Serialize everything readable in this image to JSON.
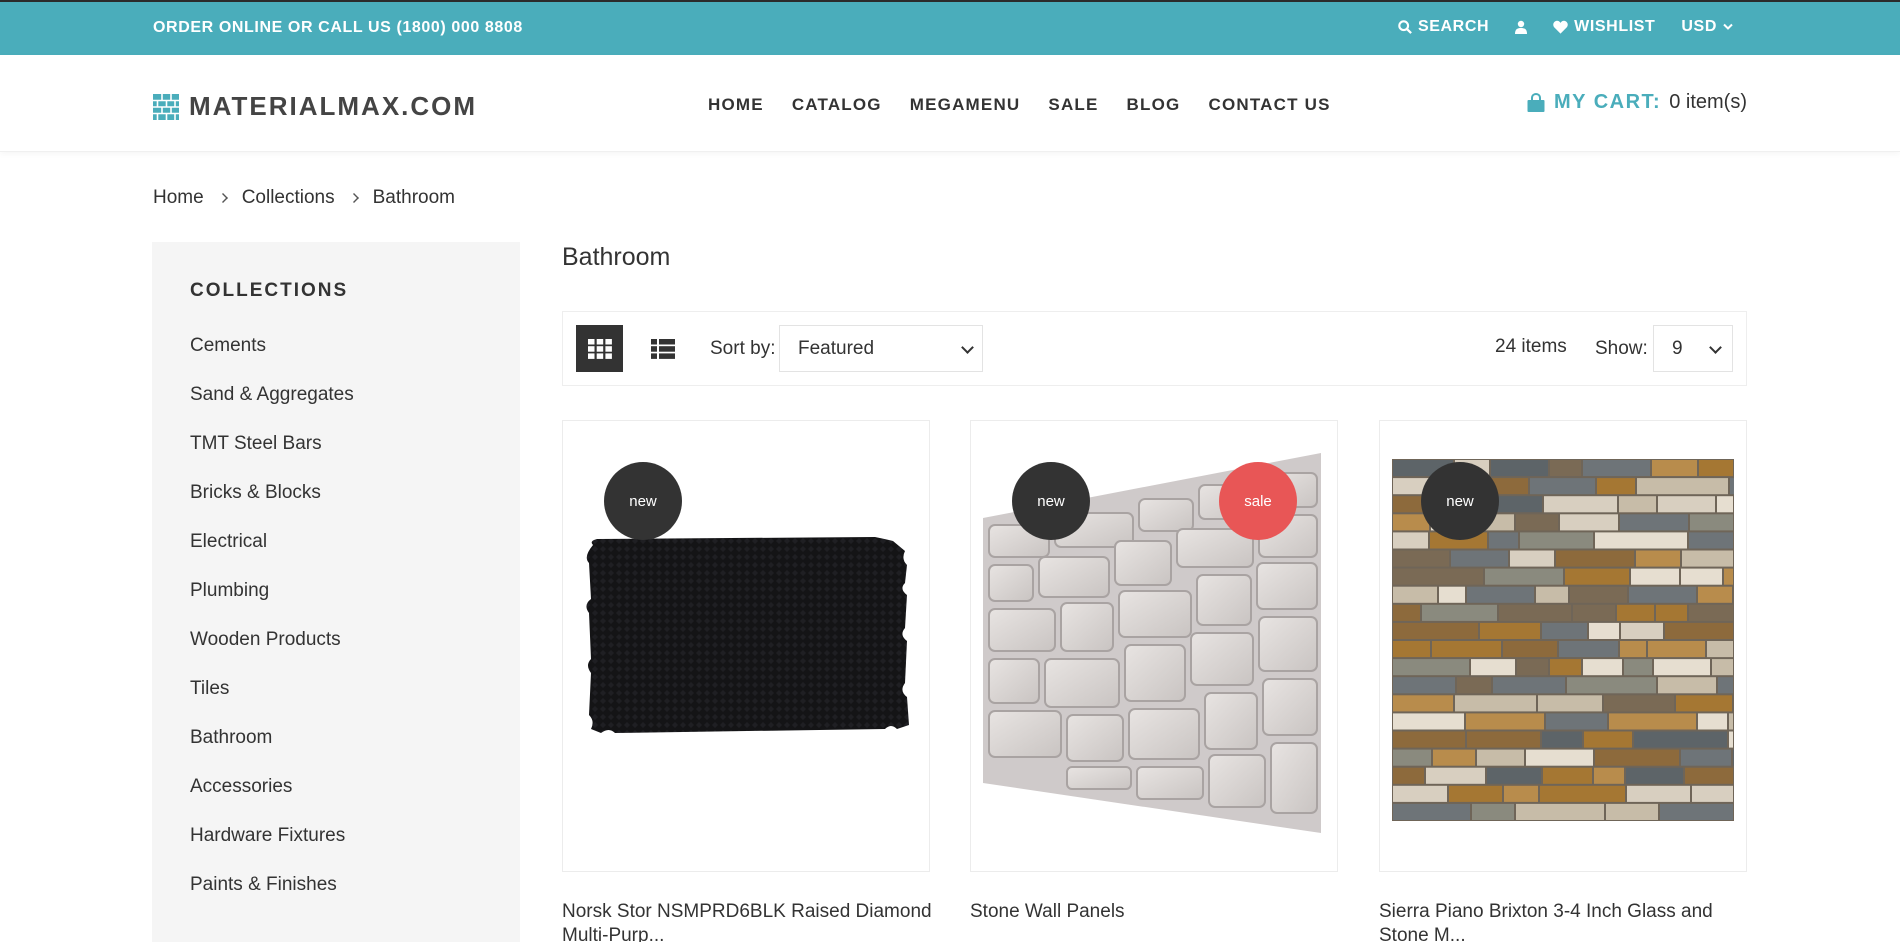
{
  "topbar": {
    "phone_text": "ORDER ONLINE OR CALL US (1800) 000 8808",
    "search_label": "SEARCH",
    "wishlist_label": "WISHLIST",
    "currency": "USD"
  },
  "header": {
    "logo_text": "MATERIALMAX.COM",
    "nav": [
      "HOME",
      "CATALOG",
      "MEGAMENU",
      "SALE",
      "BLOG",
      "CONTACT US"
    ],
    "cart_label": "MY CART:",
    "cart_count": "0 item(s)"
  },
  "breadcrumb": [
    "Home",
    "Collections",
    "Bathroom"
  ],
  "sidebar": {
    "title": "COLLECTIONS",
    "items": [
      "Cements",
      "Sand & Aggregates",
      "TMT Steel Bars",
      "Bricks & Blocks",
      "Electrical",
      "Plumbing",
      "Wooden Products",
      "Tiles",
      "Bathroom",
      "Accessories",
      "Hardware Fixtures",
      "Paints & Finishes"
    ]
  },
  "main": {
    "title": "Bathroom",
    "sort_label": "Sort by:",
    "sort_value": "Featured",
    "items_count": "24 items",
    "show_label": "Show:",
    "show_value": "9"
  },
  "products": [
    {
      "title": "Norsk Stor NSMPRD6BLK Raised Diamond Multi-Purp...",
      "badges": [
        "new"
      ]
    },
    {
      "title": "Stone Wall Panels",
      "badges": [
        "new",
        "sale"
      ]
    },
    {
      "title": "Sierra Piano Brixton 3-4 Inch Glass and Stone M...",
      "badges": [
        "new"
      ]
    }
  ],
  "colors": {
    "accent": "#4aadbb",
    "sale": "#e85656",
    "dark": "#333333"
  }
}
